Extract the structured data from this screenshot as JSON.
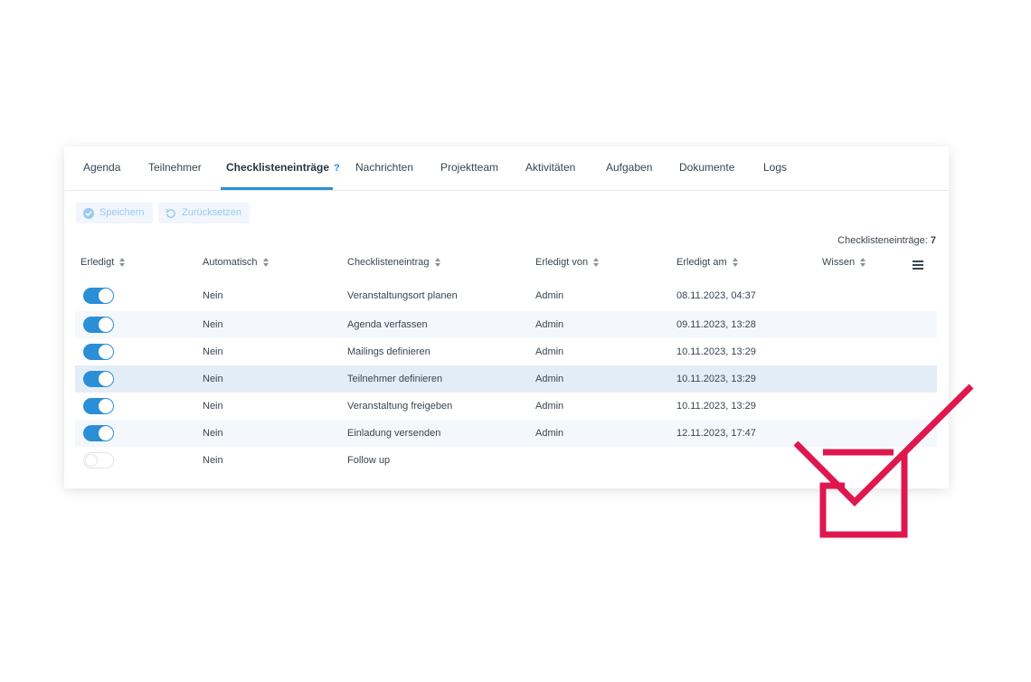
{
  "tabs": [
    {
      "label": "Agenda"
    },
    {
      "label": "Teilnehmer"
    },
    {
      "label": "Checklisteneinträge",
      "help": "?"
    },
    {
      "label": "Nachrichten"
    },
    {
      "label": "Projektteam"
    },
    {
      "label": "Aktivitäten"
    },
    {
      "label": "Aufgaben"
    },
    {
      "label": "Dokumente"
    },
    {
      "label": "Logs"
    }
  ],
  "active_tab": "Checklisteneinträge",
  "toolbar": {
    "save_label": "Speichern",
    "reset_label": "Zurücksetzen"
  },
  "count": {
    "label": "Checklisteneinträge:",
    "value": "7"
  },
  "columns": {
    "done": "Erledigt",
    "automatic": "Automatisch",
    "entry": "Checklisteneintrag",
    "done_by": "Erledigt von",
    "done_at": "Erledigt am",
    "knowledge": "Wissen"
  },
  "rows": [
    {
      "done": true,
      "automatic": "Nein",
      "entry": "Veranstaltungsort planen",
      "done_by": "Admin",
      "done_at": "08.11.2023, 04:37"
    },
    {
      "done": true,
      "automatic": "Nein",
      "entry": "Agenda verfassen",
      "done_by": "Admin",
      "done_at": "09.11.2023, 13:28"
    },
    {
      "done": true,
      "automatic": "Nein",
      "entry": "Mailings definieren",
      "done_by": "Admin",
      "done_at": "10.11.2023, 13:29"
    },
    {
      "done": true,
      "automatic": "Nein",
      "entry": "Teilnehmer definieren",
      "done_by": "Admin",
      "done_at": "10.11.2023, 13:29"
    },
    {
      "done": true,
      "automatic": "Nein",
      "entry": "Veranstaltung freigeben",
      "done_by": "Admin",
      "done_at": "10.11.2023, 13:29"
    },
    {
      "done": true,
      "automatic": "Nein",
      "entry": "Einladung versenden",
      "done_by": "Admin",
      "done_at": "12.11.2023, 17:47"
    },
    {
      "done": false,
      "automatic": "Nein",
      "entry": "Follow up",
      "done_by": "",
      "done_at": ""
    }
  ],
  "colors": {
    "accent": "#2a8fd6",
    "row_stripe": "#f4f8fc",
    "row_hover": "#e3edf8",
    "checkmark": "#e0174f"
  },
  "icons": {
    "save": "check-circle-icon",
    "reset": "undo-icon",
    "sort": "sort-icon",
    "column_menu": "hamburger-menu-icon",
    "decoration": "checkbox-checkmark-icon"
  }
}
